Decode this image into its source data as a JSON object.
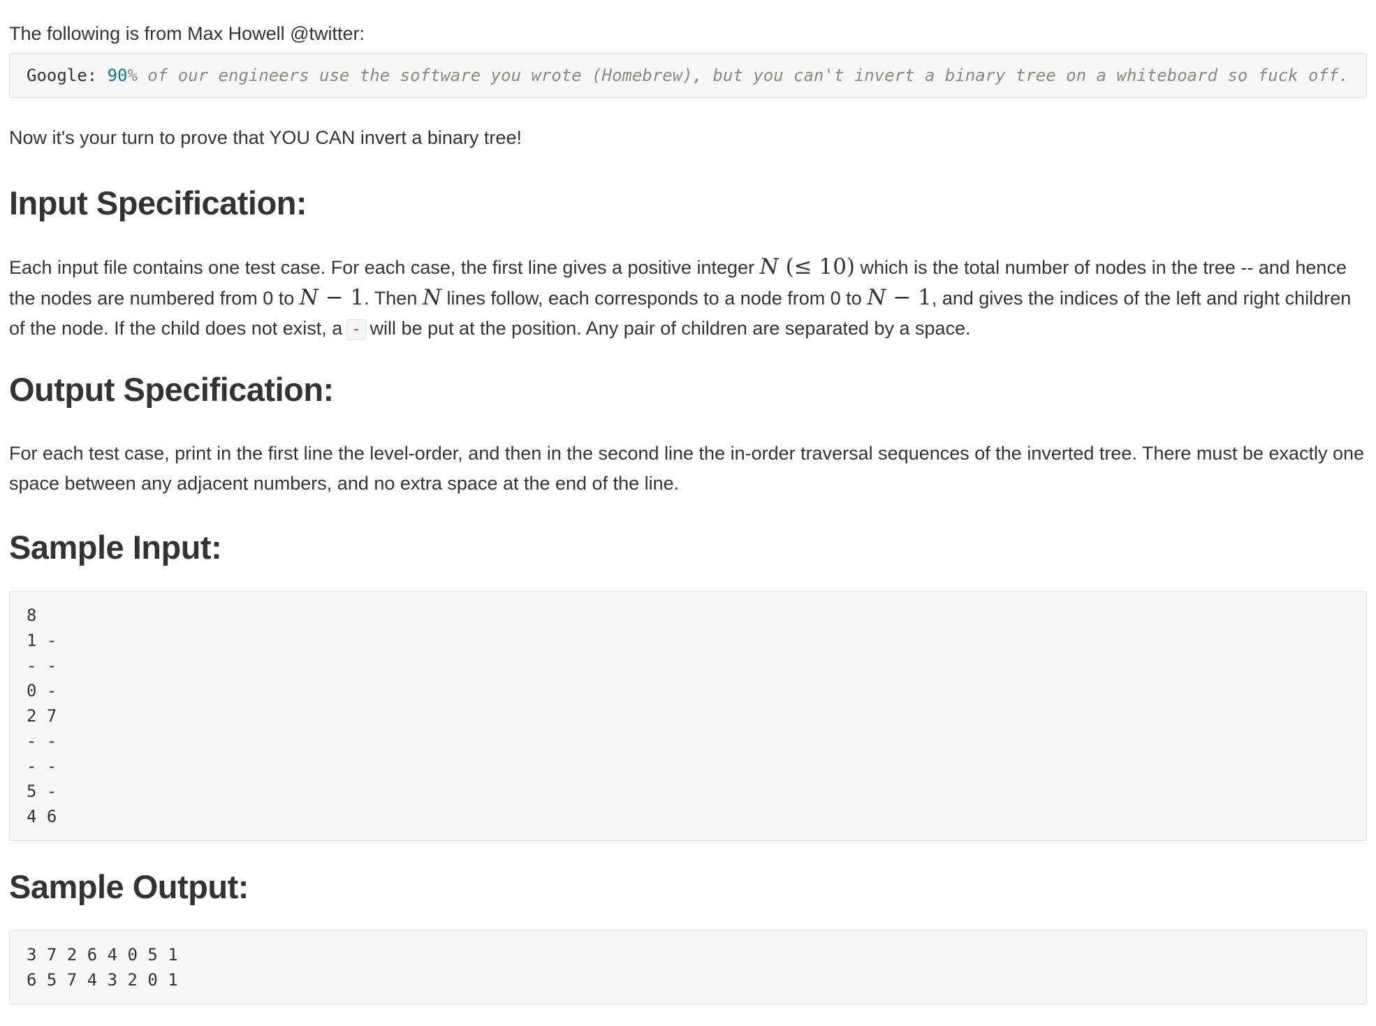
{
  "intro": "The following is from Max Howell @twitter:",
  "quote": {
    "key": "Google: ",
    "num": "90",
    "rest": "% of our engineers use the software you wrote (Homebrew), but you can't invert a binary tree on a whiteboard so fuck off."
  },
  "turn": "Now it's your turn to prove that YOU CAN invert a binary tree!",
  "input_spec": {
    "heading": "Input Specification:",
    "t1": "Each input file contains one test case. For each case, the first line gives a positive integer ",
    "m_N1": "N",
    "m_le": " (≤ 10)",
    "t2": " which is the total number of nodes in the tree -- and hence the nodes are numbered from 0 to ",
    "m_N2": "N",
    "m_minus1": " − 1",
    "t3": ". Then ",
    "m_N3": "N",
    "t4": " lines follow, each corresponds to a node from 0 to ",
    "m_N4": "N",
    "m_minus2": " − 1",
    "t5": ", and gives the indices of the left and right children of the node. If the child does not exist, a",
    "code_dash": "-",
    "t6": "will be put at the position. Any pair of children are separated by a space."
  },
  "output_spec": {
    "heading": "Output Specification:",
    "text": "For each test case, print in the first line the level-order, and then in the second line the in-order traversal sequences of the inverted tree. There must be exactly one space between any adjacent numbers, and no extra space at the end of the line."
  },
  "sample_input": {
    "heading": "Sample Input:",
    "lines": [
      "8",
      "1 -",
      "- -",
      "0 -",
      "2 7",
      "- -",
      "- -",
      "5 -",
      "4 6"
    ]
  },
  "sample_output": {
    "heading": "Sample Output:",
    "lines": [
      "3 7 2 6 4 0 5 1",
      "6 5 7 4 3 2 0 1"
    ]
  }
}
